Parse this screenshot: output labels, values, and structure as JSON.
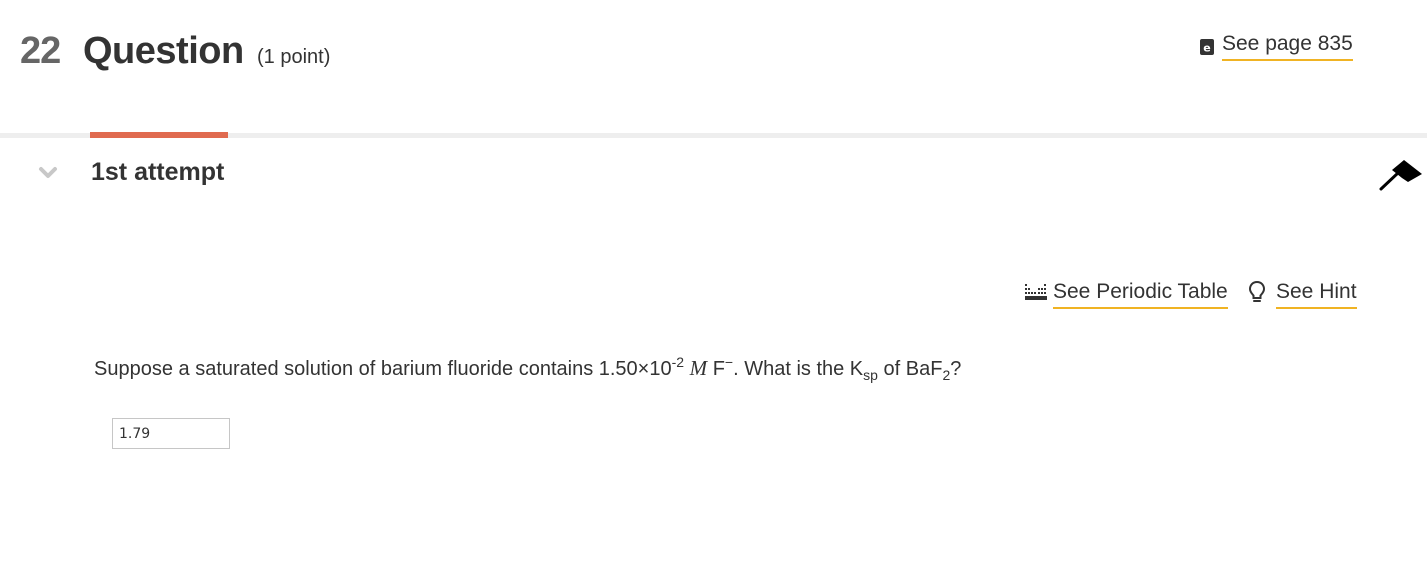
{
  "header": {
    "question_number": "22",
    "question_label": "Question",
    "points": "(1 point)",
    "see_page_label": "See page 835"
  },
  "attempt": {
    "label": "1st attempt"
  },
  "tools": {
    "periodic_table_label": "See Periodic Table",
    "hint_label": "See Hint"
  },
  "question": {
    "part1": "Suppose a saturated solution of barium fluoride contains 1.50×10",
    "exponent": "-2",
    "unit": "M",
    "ion": "F",
    "ion_charge": "−",
    "part2": ". What is the K",
    "ksp_subscript": "sp",
    "part3": " of BaF",
    "formula_subscript": "2",
    "part4": "?"
  },
  "answer": {
    "value": "1.79"
  },
  "colors": {
    "accent_tab": "#e06a4f",
    "link_underline": "#f0b323",
    "divider": "#eeeeee"
  },
  "icons": {
    "book": "book-icon",
    "chevron": "chevron-down-icon",
    "pin": "pin-icon",
    "periodic_table": "periodic-table-icon",
    "hint": "lightbulb-icon"
  }
}
